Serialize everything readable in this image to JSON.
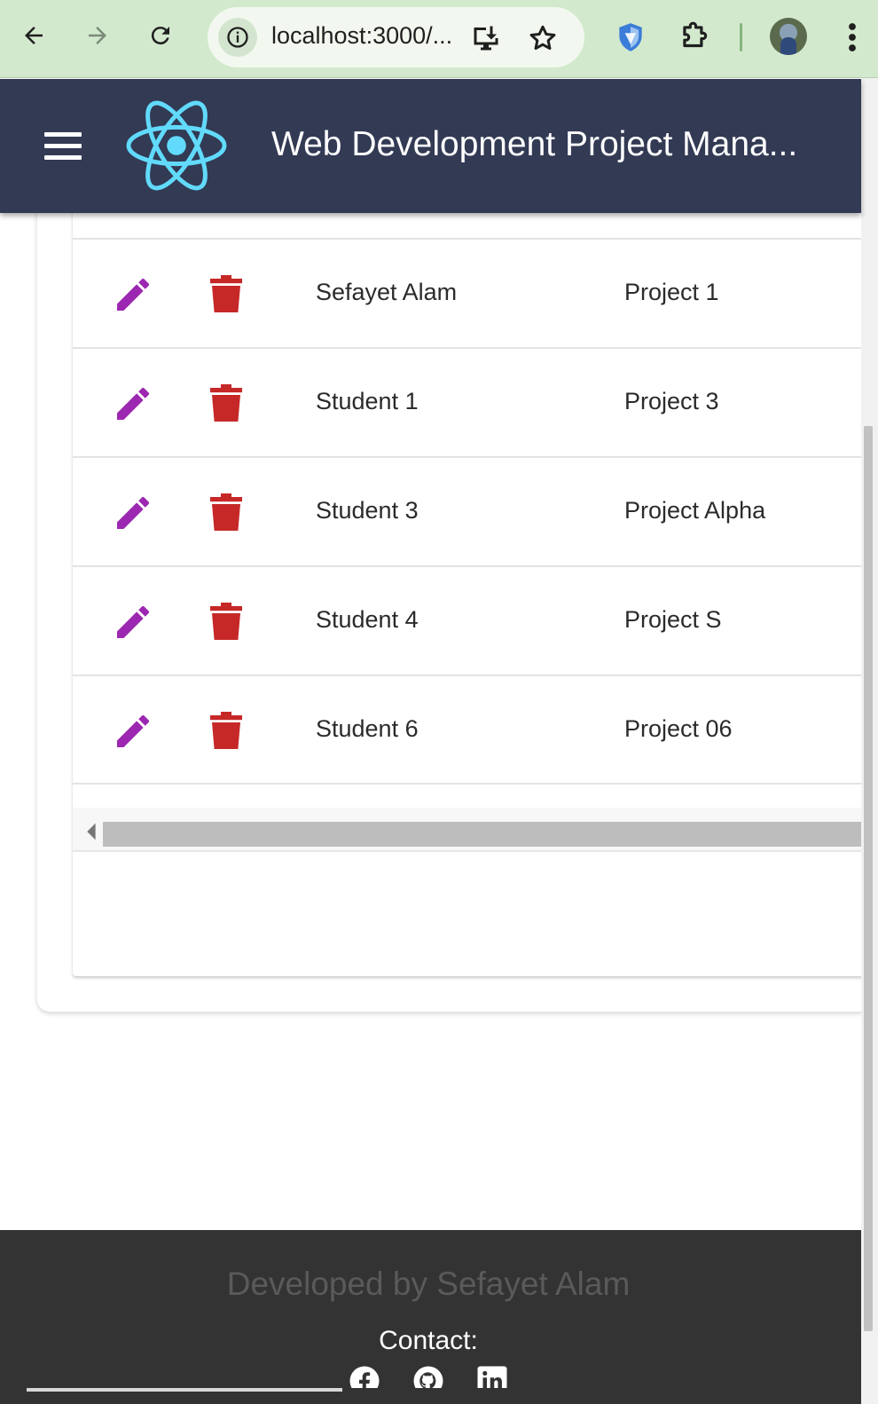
{
  "browser": {
    "url": "localhost:3000/..."
  },
  "app_bar": {
    "title": "Web Development Project Mana..."
  },
  "table": {
    "rows": [
      {
        "name": "Sefayet Alam",
        "project": "Project 1"
      },
      {
        "name": "Student 1",
        "project": "Project 3"
      },
      {
        "name": "Student 3",
        "project": "Project Alpha"
      },
      {
        "name": "Student 4",
        "project": "Project S"
      },
      {
        "name": "Student 6",
        "project": "Project 06"
      }
    ]
  },
  "footer": {
    "credit": "Developed by Sefayet Alam",
    "contact_label": "Contact:",
    "social_icons": [
      "facebook-icon",
      "github-icon",
      "linkedin-icon"
    ]
  },
  "colors": {
    "browser_bar": "#d3e9cd",
    "app_bar": "#323a54",
    "react_logo": "#61dafb",
    "edit_icon": "#9c27b0",
    "delete_icon": "#c62828",
    "footer": "#333333"
  },
  "icons": {
    "browser": [
      "back-arrow-icon",
      "forward-arrow-icon",
      "reload-icon",
      "site-info-icon",
      "install-app-icon",
      "bookmark-star-icon",
      "shield-extension-icon",
      "extensions-puzzle-icon",
      "profile-avatar",
      "more-menu-icon"
    ],
    "app": [
      "hamburger-menu-icon",
      "react-logo"
    ]
  }
}
